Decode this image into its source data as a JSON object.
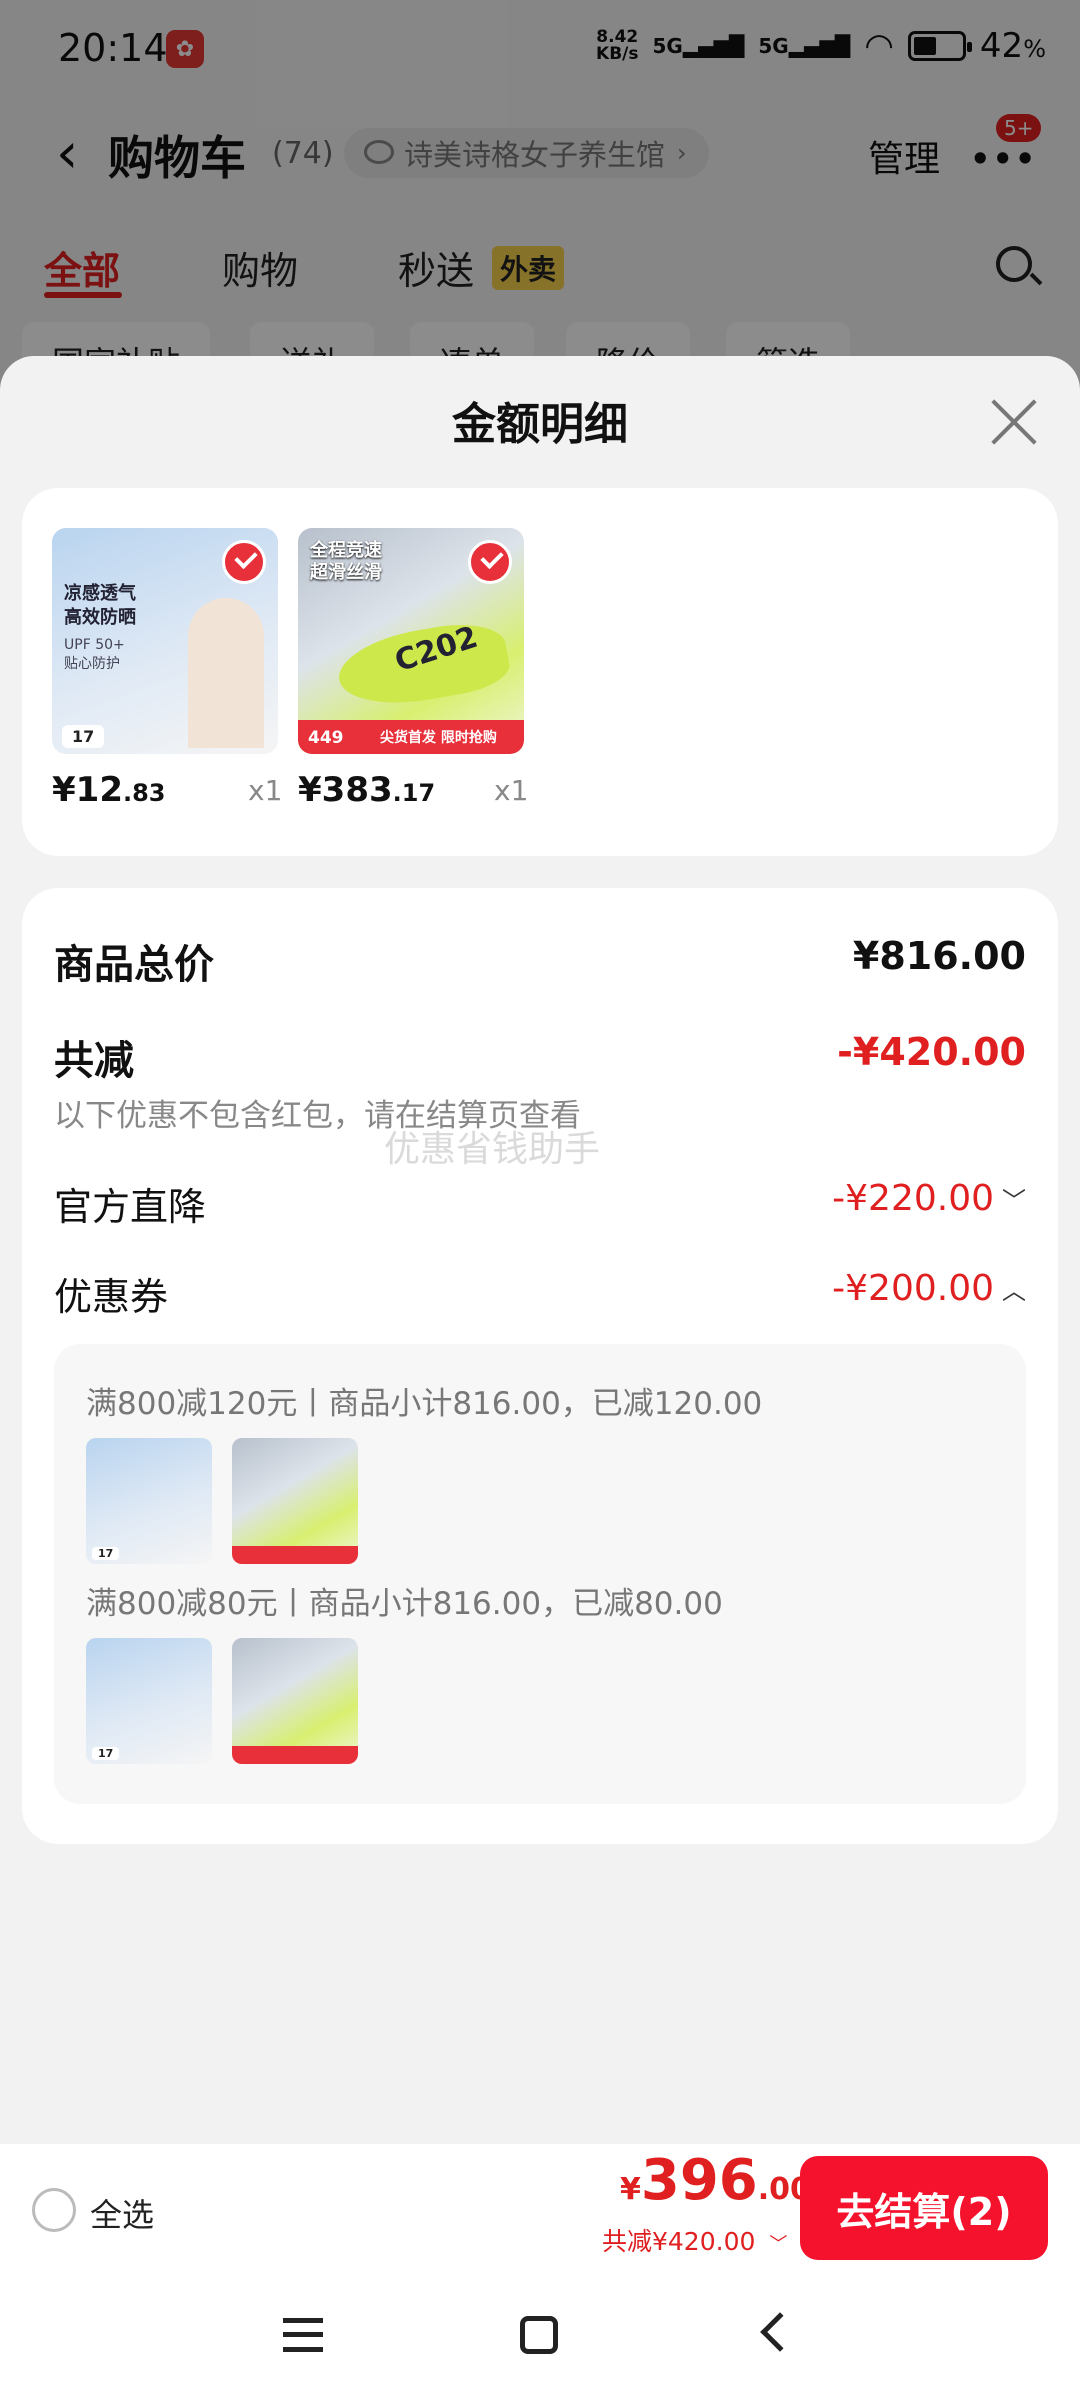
{
  "status_bar": {
    "time": "20:14",
    "net_speed_value": "8.42",
    "net_speed_unit": "KB/s",
    "network": "5G",
    "network2": "5G",
    "battery": "42",
    "battery_unit": "%"
  },
  "header": {
    "title": "购物车",
    "count": "(74)",
    "store_name": "诗美诗格女子养生馆",
    "manage": "管理",
    "more_badge": "5+"
  },
  "tabs": [
    {
      "label": "全部"
    },
    {
      "label": "购物"
    },
    {
      "label": "秒送"
    }
  ],
  "tab_badge": "外卖",
  "chips": [
    "国家补贴",
    "送礼",
    "凑单",
    "降价",
    "筛选"
  ],
  "sheet": {
    "title": "金额明细"
  },
  "products": [
    {
      "price_int": "¥12",
      "price_dec": ".83",
      "qty": "x1",
      "art_text": "凉感透气\n高效防晒",
      "art_sub": "UPF 50+\n贴心防护",
      "art_price": "17"
    },
    {
      "price_int": "¥383",
      "price_dec": ".17",
      "qty": "x1",
      "art_text": "全程竞速\n超滑丝滑",
      "art_price": "449",
      "art_tag": "尖货首发 限时抢购",
      "art_model": "C202"
    }
  ],
  "summary": {
    "total_label": "商品总价",
    "total_value": "¥816.00",
    "reduce_label": "共减",
    "reduce_value": "-¥420.00",
    "reduce_note": "以下优惠不包含红包，请在结算页查看",
    "watermark": "优惠省钱助手",
    "official_label": "官方直降",
    "official_value": "-¥220.00",
    "coupon_label": "优惠券",
    "coupon_value": "-¥200.00",
    "coupons": [
      {
        "text": "满800减120元丨商品小计816.00，已减120.00"
      },
      {
        "text": "满800减80元丨商品小计816.00，已减80.00"
      }
    ]
  },
  "bottom_bar": {
    "select_all": "全选",
    "total_symbol": "¥",
    "total_int": "396",
    "total_dec": ".00",
    "reduce_summary": "共减¥420.00",
    "checkout": "去结算(2)"
  },
  "colors": {
    "accent": "#e02020",
    "checkout_bg": "#f5122d",
    "tab_badge_bg": "#f6d04d"
  }
}
